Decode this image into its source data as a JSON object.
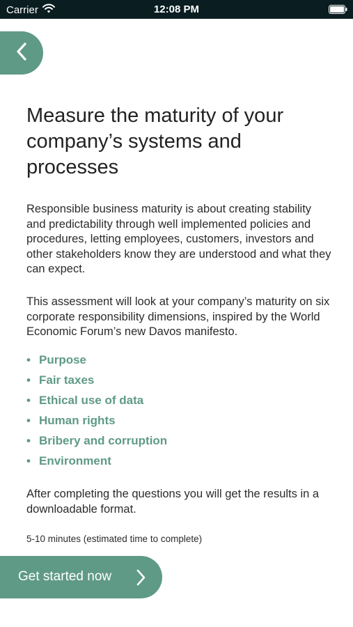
{
  "status_bar": {
    "carrier": "Carrier",
    "time": "12:08 PM",
    "icons": [
      "wifi-icon",
      "battery-icon"
    ]
  },
  "nav": {
    "back_icon": "chevron-left-icon"
  },
  "content": {
    "title": "Measure the maturity of your company’s systems and processes",
    "intro": "Responsible business maturity is about creating stability and predictability through well implemented policies and procedures, letting employees, customers, investors and other stakeholders know they are understood and what they can expect.",
    "assessment": "This assessment will look at your company’s maturity on six corporate responsibility dimensions, inspired by the World Economic Forum’s new Davos manifesto.",
    "bullet": "•",
    "dimensions": [
      "Purpose",
      "Fair taxes",
      "Ethical use of data",
      "Human rights",
      "Bribery and corruption",
      "Environment"
    ],
    "results_note": "After completing the questions you will get the results in a downloadable format.",
    "estimated_time": "5-10 minutes (estimated time to complete)"
  },
  "cta": {
    "label": "Get started now",
    "icon": "chevron-right-icon"
  },
  "colors": {
    "accent": "#5f9a86",
    "status_bar": "#0a1e22",
    "text": "#2b2b2b",
    "background": "#ffffff"
  }
}
